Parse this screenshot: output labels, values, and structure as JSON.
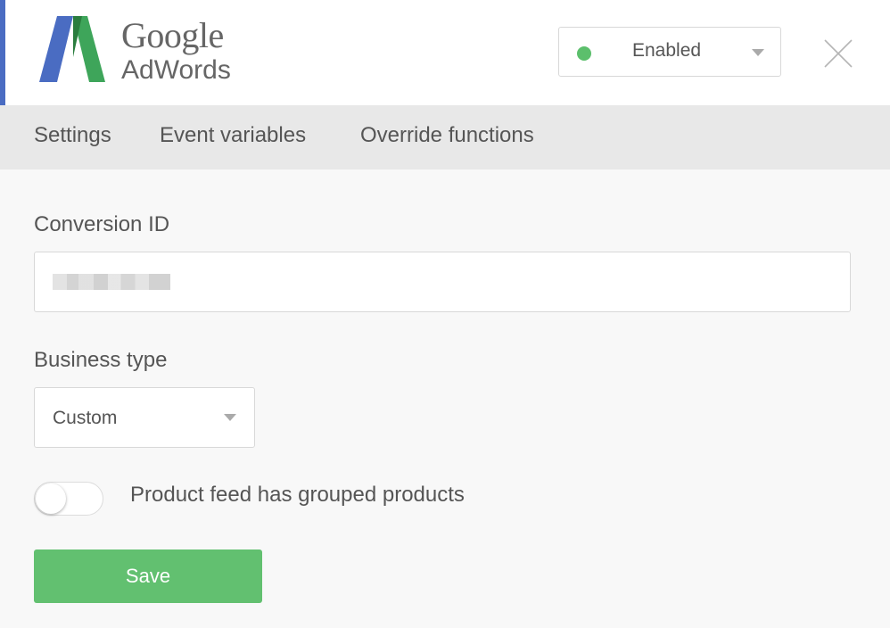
{
  "header": {
    "logo": {
      "line1": "Google",
      "line2": "AdWords",
      "colors": {
        "blue": "#4a6cc2",
        "green": "#3ea55a",
        "dark_green": "#2a7d3e",
        "yellow_green": "#7ec88a"
      }
    },
    "status": {
      "label": "Enabled",
      "dot_color": "#5cbf6c",
      "options_visible": [
        "Enabled"
      ]
    },
    "close_icon": "close-icon",
    "accent_color": "#4a6cc2"
  },
  "tabs": [
    {
      "label": "Settings"
    },
    {
      "label": "Event variables"
    },
    {
      "label": "Override functions"
    }
  ],
  "form": {
    "conversion_id": {
      "label": "Conversion ID",
      "value_redacted": true
    },
    "business_type": {
      "label": "Business type",
      "value": "Custom"
    },
    "grouped_products": {
      "label": "Product feed has grouped products",
      "checked": false
    },
    "save_label": "Save",
    "save_color": "#62c070"
  }
}
